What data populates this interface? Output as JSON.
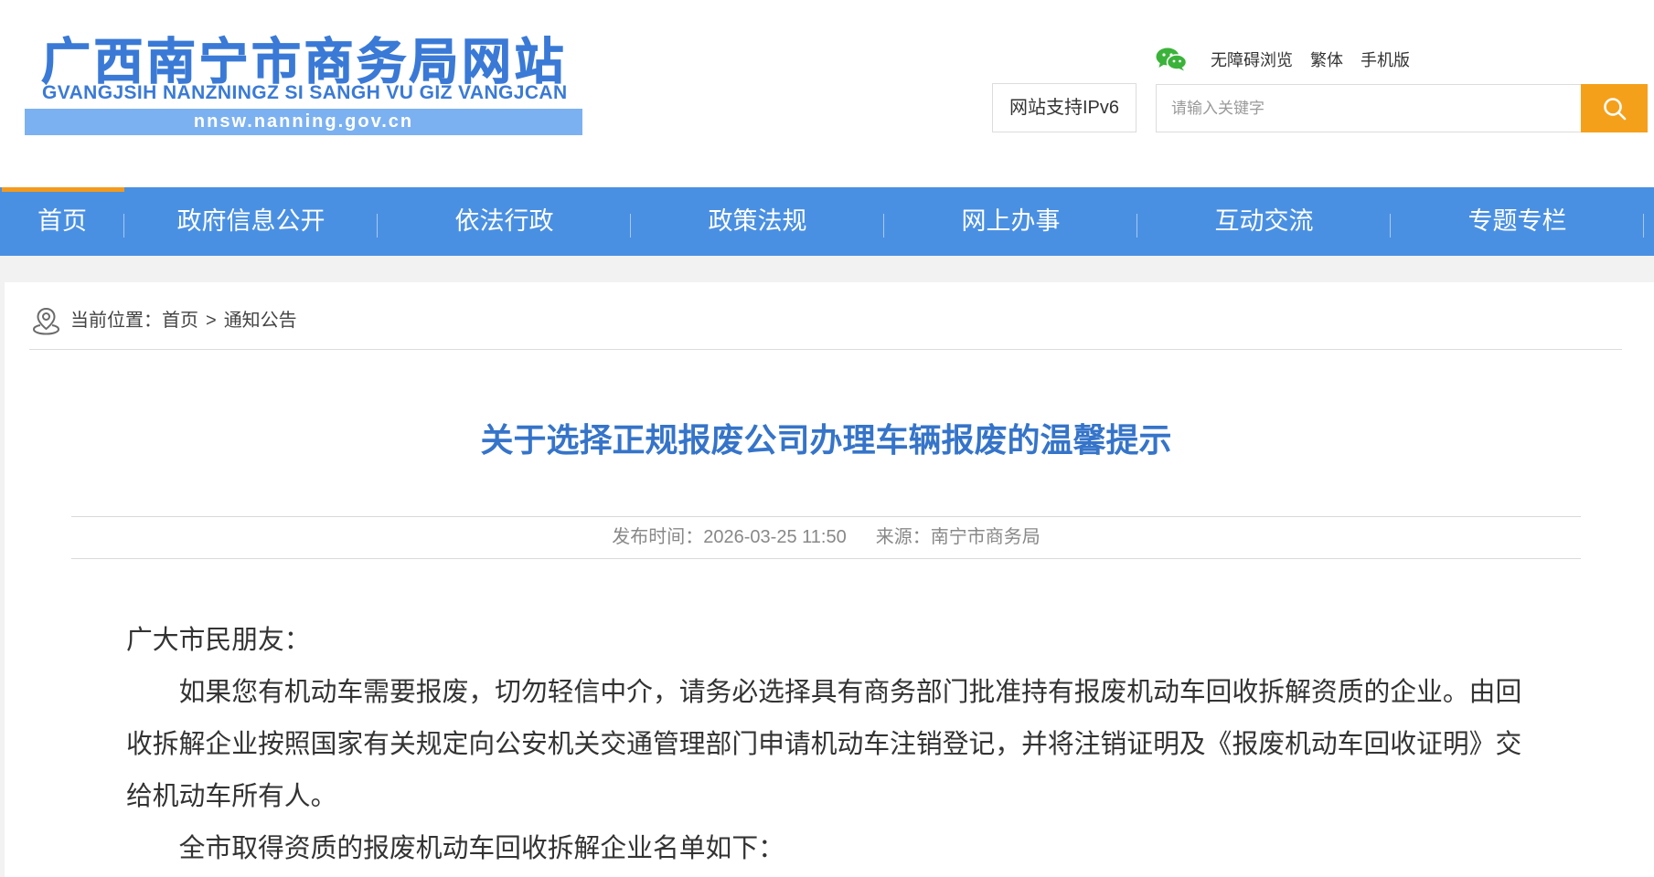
{
  "site": {
    "logo_title": "广西南宁市商务局网站",
    "logo_subtitle": "GVANGJSIH NANZNINGZ SI SANGH VU GIZ VANGJCAN",
    "logo_domain": "nnsw.nanning.gov.cn"
  },
  "toolbar": {
    "icon": "wechat-icon",
    "links": [
      {
        "label": "无障碍浏览"
      },
      {
        "label": "繁体"
      },
      {
        "label": "手机版"
      }
    ],
    "ipv6_label": "网站支持IPv6"
  },
  "search": {
    "placeholder": "请输入关键字",
    "value": "",
    "button_icon": "search-icon"
  },
  "nav": {
    "items": [
      {
        "label": "首页",
        "active": true
      },
      {
        "label": "政府信息公开",
        "active": false
      },
      {
        "label": "依法行政",
        "active": false
      },
      {
        "label": "政策法规",
        "active": false
      },
      {
        "label": "网上办事",
        "active": false
      },
      {
        "label": "互动交流",
        "active": false
      },
      {
        "label": "专题专栏",
        "active": false
      }
    ]
  },
  "breadcrumb": {
    "icon": "location-icon",
    "prefix": "当前位置：",
    "home": "首页",
    "separator": ">",
    "current": "通知公告"
  },
  "article": {
    "title": "关于选择正规报废公司办理车辆报废的温馨提示",
    "publish_label": "发布时间：",
    "publish_time": "2026-03-25 11:50",
    "source_label": "来源：",
    "source": "南宁市商务局",
    "salutation": "广大市民朋友：",
    "paragraphs": [
      "如果您有机动车需要报废，切勿轻信中介，请务必选择具有商务部门批准持有报废机动车回收拆解资质的企业。由回收拆解企业按照国家有关规定向公安机关交通管理部门申请机动车注销登记，并将注销证明及《报废机动车回收证明》交给机动车所有人。",
      "全市取得资质的报废机动车回收拆解企业名单如下："
    ]
  },
  "colors": {
    "logo_blue": "#3a7ad6",
    "logo_bar": "#7cb1f1",
    "nav_bg": "#4a90e2",
    "nav_active_indicator": "#f39a1e",
    "search_button": "#f5a01a",
    "title_blue": "#3574c9",
    "wechat_green": "#3bb33a",
    "page_bg": "#f2f2f2"
  }
}
